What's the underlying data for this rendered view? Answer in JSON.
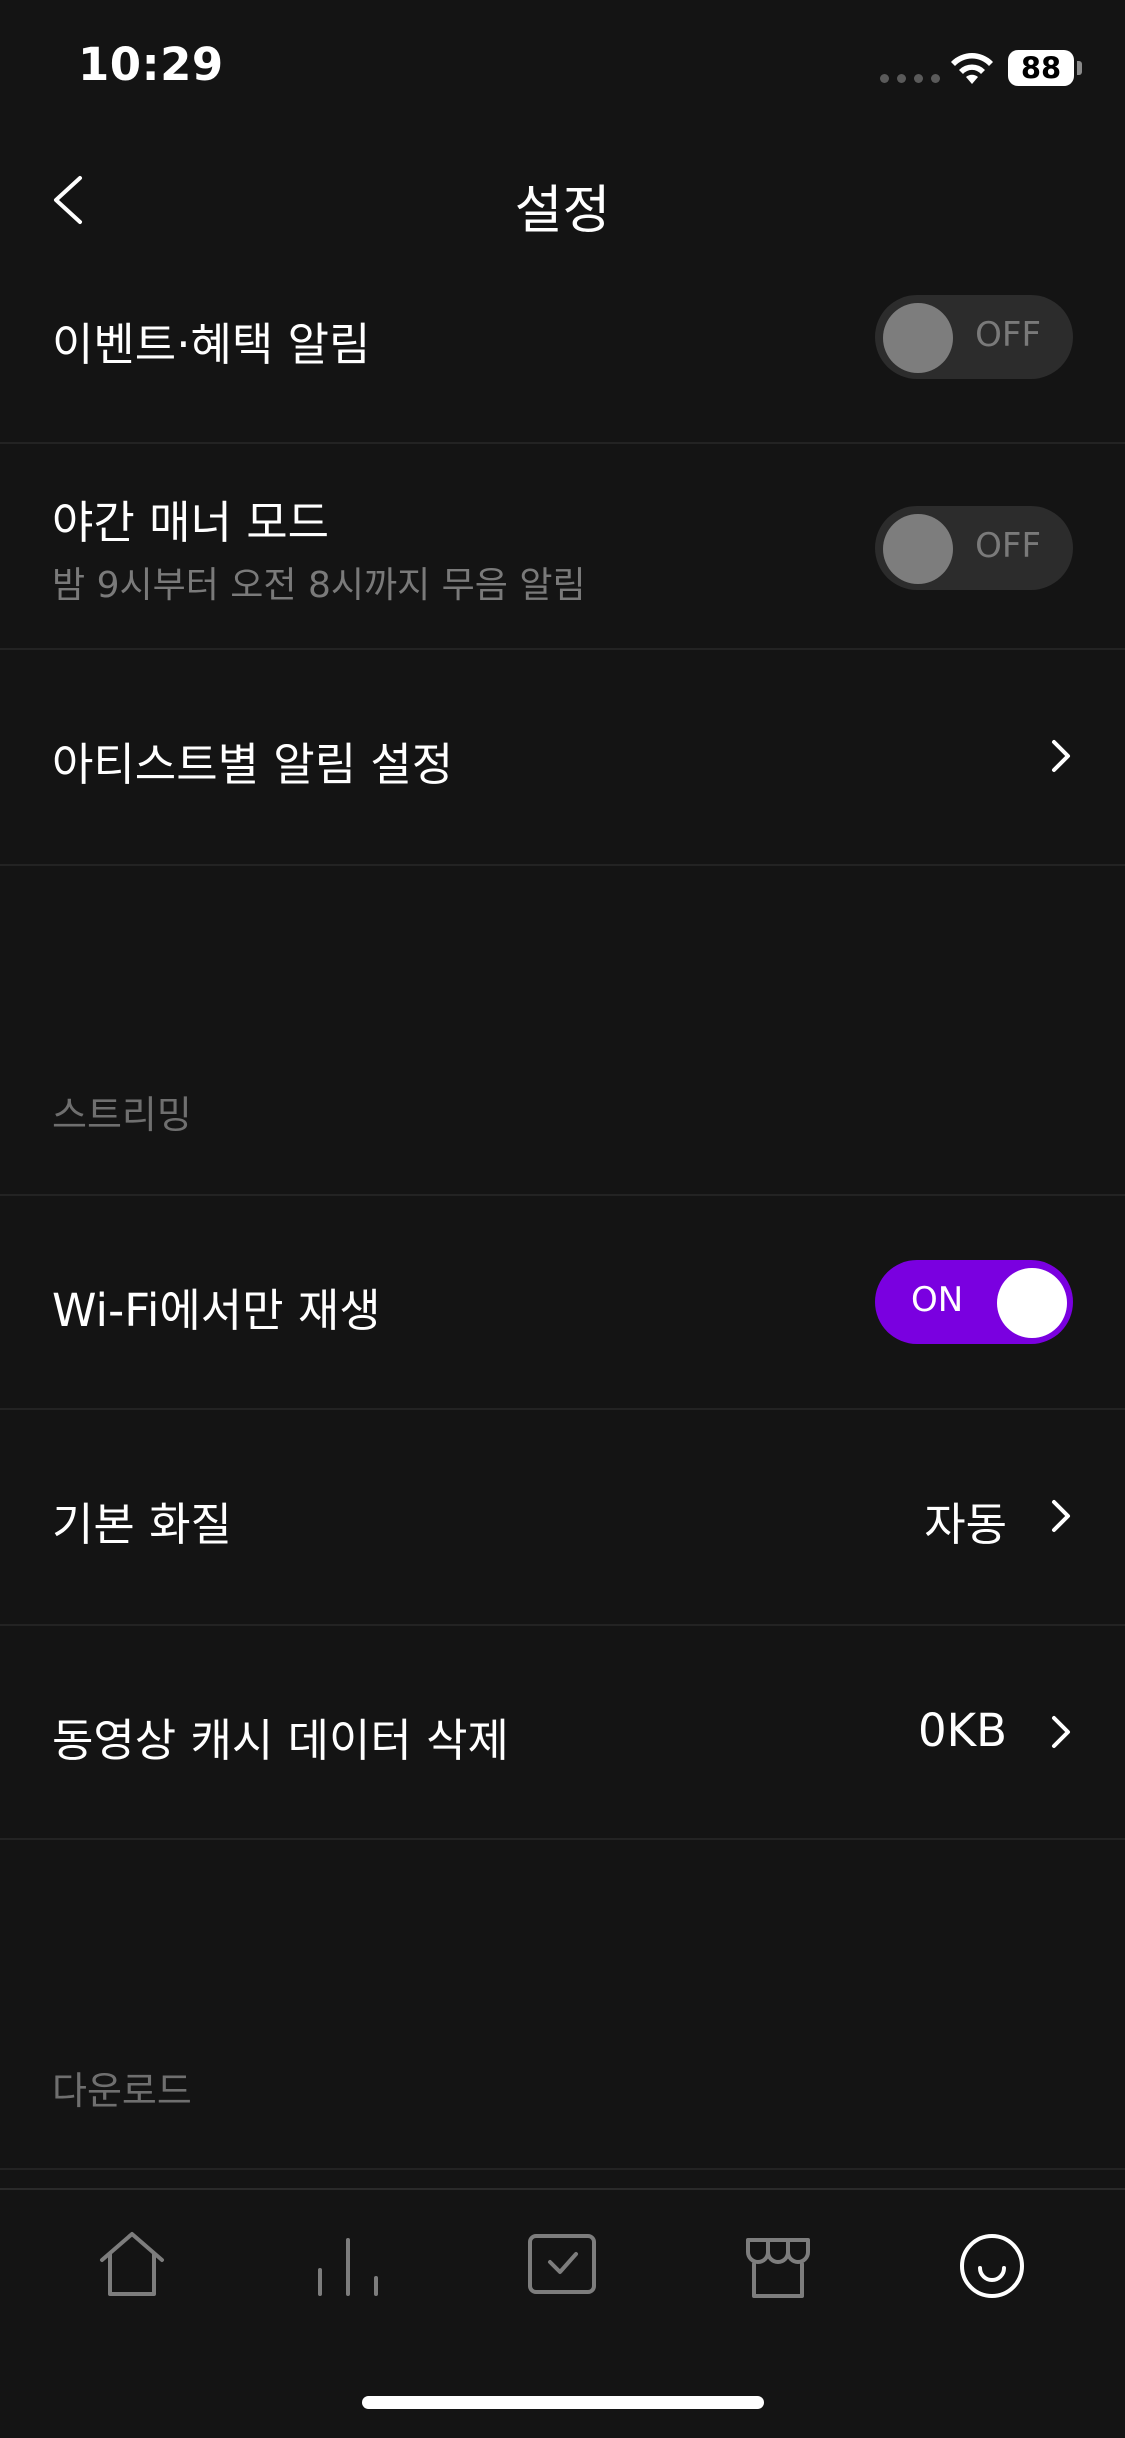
{
  "status_bar": {
    "time": "10:29",
    "battery": "88"
  },
  "header": {
    "title": "설정"
  },
  "notifications": {
    "event_alert": {
      "label": "이벤트·혜택 알림",
      "toggle": "OFF"
    },
    "night_mode": {
      "label": "야간 매너 모드",
      "description": "밤 9시부터 오전 8시까지 무음 알림",
      "toggle": "OFF"
    },
    "artist_alert": {
      "label": "아티스트별 알림 설정"
    }
  },
  "streaming": {
    "section_title": "스트리밍",
    "wifi_only": {
      "label": "Wi-Fi에서만 재생",
      "toggle": "ON"
    },
    "quality": {
      "label": "기본 화질",
      "value": "자동"
    },
    "video_cache": {
      "label": "동영상 캐시 데이터 삭제",
      "value": "0KB"
    }
  },
  "download": {
    "section_title": "다운로드"
  },
  "tabbar": {
    "tabs": [
      "home-icon",
      "chart-icon",
      "library-icon",
      "store-icon",
      "profile-icon"
    ],
    "active_index": 4
  },
  "colors": {
    "accent": "#7a00e0",
    "background": "#141414",
    "divider": "#232323"
  }
}
